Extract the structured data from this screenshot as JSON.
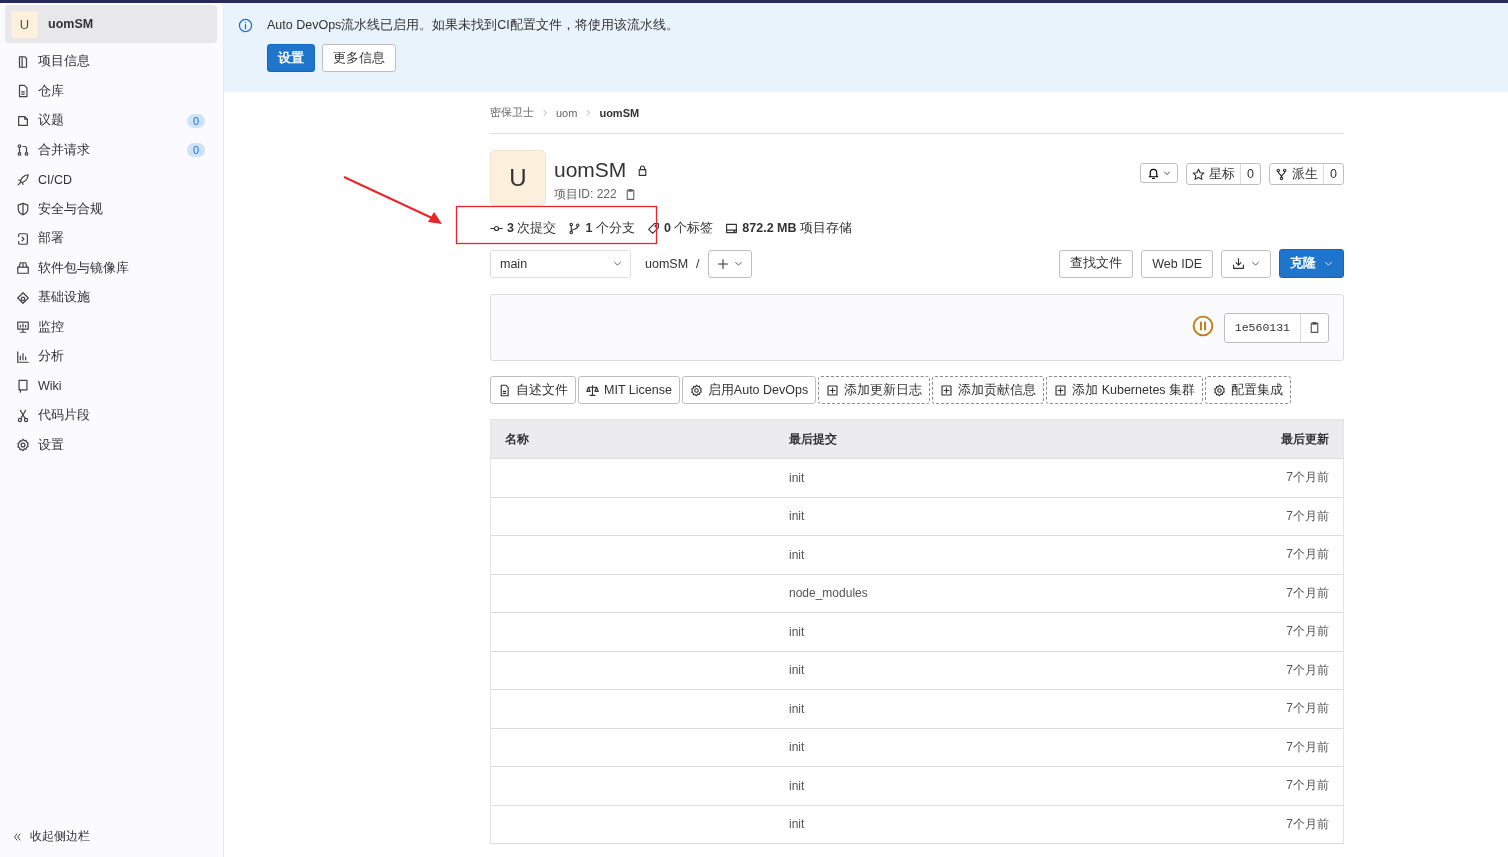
{
  "sidebar": {
    "project": {
      "avatar": "U",
      "name": "uomSM"
    },
    "items": [
      {
        "label": "项目信息"
      },
      {
        "label": "仓库"
      },
      {
        "label": "议题",
        "count": "0"
      },
      {
        "label": "合并请求",
        "count": "0"
      },
      {
        "label": "CI/CD"
      },
      {
        "label": "安全与合规"
      },
      {
        "label": "部署"
      },
      {
        "label": "软件包与镜像库"
      },
      {
        "label": "基础设施"
      },
      {
        "label": "监控"
      },
      {
        "label": "分析"
      },
      {
        "label": "Wiki"
      },
      {
        "label": "代码片段"
      },
      {
        "label": "设置"
      }
    ],
    "collapse": "收起侧边栏"
  },
  "banner": {
    "message": "Auto DevOps流水线已启用。如果未找到CI配置文件，将使用该流水线。",
    "buttons": [
      {
        "label": "设置",
        "kind": "primary"
      },
      {
        "label": "更多信息",
        "kind": "default"
      }
    ]
  },
  "breadcrumbs": [
    "密保卫士",
    "uom",
    "uomSM"
  ],
  "project": {
    "avatar": "U",
    "name": "uomSM",
    "id": "项目ID: 222",
    "stats": [
      {
        "value": "3",
        "label": "次提交"
      },
      {
        "value": "1",
        "label": "个分支"
      },
      {
        "value": "0",
        "label": "个标签"
      },
      {
        "value": "872.2 MB",
        "label": "项目存储"
      }
    ],
    "star": {
      "label": "星标",
      "count": "0"
    },
    "fork": {
      "label": "派生",
      "count": "0"
    }
  },
  "toolbar": {
    "branch": "main",
    "path": "uomSM",
    "separator": "/",
    "buttons": [
      "查找文件",
      "Web IDE"
    ],
    "clone": "克隆"
  },
  "commit": {
    "sha": "1e560131"
  },
  "shortcuts": [
    {
      "label": "自述文件",
      "kind": "existing"
    },
    {
      "label": "MIT License",
      "kind": "existing"
    },
    {
      "label": "启用Auto DevOps",
      "kind": "existing"
    },
    {
      "label": "添加更新日志",
      "kind": "suggested"
    },
    {
      "label": "添加贡献信息",
      "kind": "suggested"
    },
    {
      "label": "添加 Kubernetes 集群",
      "kind": "suggested"
    },
    {
      "label": "配置集成",
      "kind": "suggested"
    }
  ],
  "table": {
    "columns": [
      "名称",
      "最后提交",
      "最后更新"
    ],
    "rows": [
      {
        "commit": "init",
        "updated": "7个月前"
      },
      {
        "commit": "init",
        "updated": "7个月前"
      },
      {
        "commit": "init",
        "updated": "7个月前"
      },
      {
        "commit": "node_modules",
        "updated": "7个月前"
      },
      {
        "commit": "init",
        "updated": "7个月前"
      },
      {
        "commit": "init",
        "updated": "7个月前"
      },
      {
        "commit": "init",
        "updated": "7个月前"
      },
      {
        "commit": "init",
        "updated": "7个月前"
      },
      {
        "commit": "init",
        "updated": "7个月前"
      },
      {
        "commit": "init",
        "updated": "7个月前"
      }
    ]
  }
}
